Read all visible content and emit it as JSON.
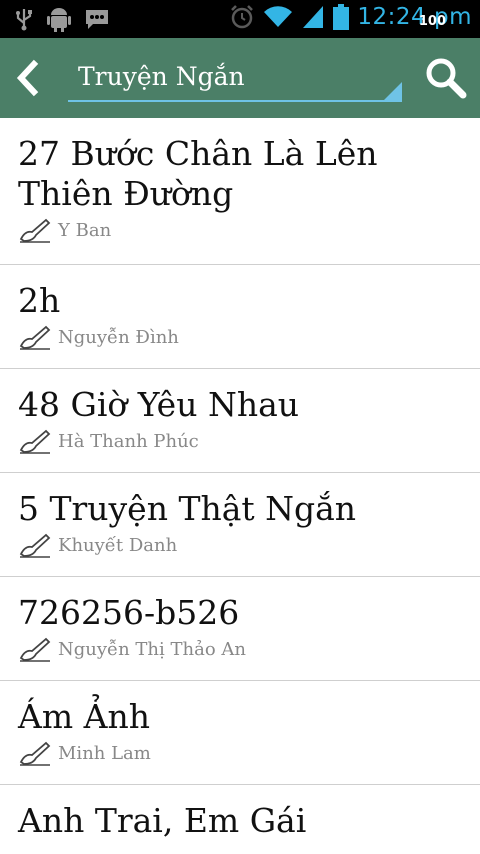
{
  "status_bar": {
    "time": "12:24 pm",
    "battery_level": "100",
    "icons": [
      "usb-icon",
      "android-debug-icon",
      "message-icon",
      "alarm-icon",
      "wifi-icon",
      "signal-icon",
      "battery-icon"
    ]
  },
  "action_bar": {
    "title": "Truyện Ngắn",
    "back_icon": "back-arrow-icon",
    "search_icon": "search-icon",
    "accent_color": "#6fc3e6",
    "bar_color": "#4b7f67"
  },
  "stories": [
    {
      "title": "27 Bước Chân Là Lên Thiên Đường",
      "author": "Y Ban"
    },
    {
      "title": "2h",
      "author": "Nguyễn Đình"
    },
    {
      "title": "48 Giờ Yêu Nhau",
      "author": "Hà Thanh Phúc"
    },
    {
      "title": "5 Truyện Thật Ngắn",
      "author": "Khuyết Danh"
    },
    {
      "title": "726256-b526",
      "author": "Nguyễn Thị Thảo An"
    },
    {
      "title": "Ám Ảnh",
      "author": "Minh Lam"
    },
    {
      "title": "Anh Trai, Em Gái",
      "author": ""
    }
  ]
}
